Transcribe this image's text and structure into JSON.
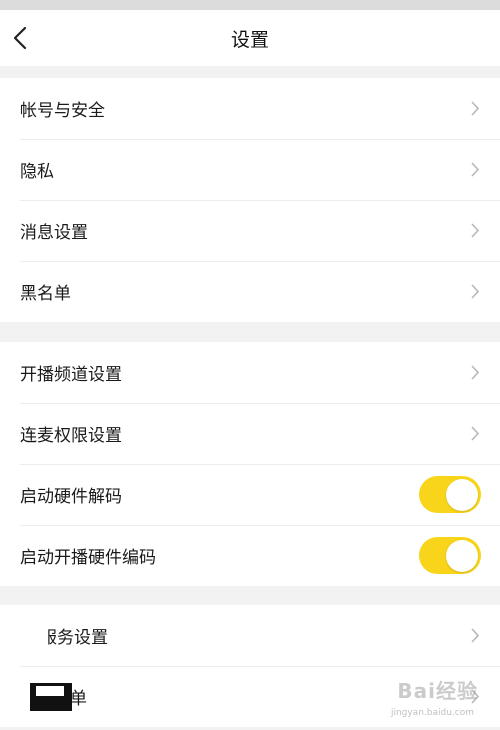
{
  "header": {
    "title": "设置"
  },
  "groups": [
    {
      "items": [
        {
          "label": "帐号与安全",
          "type": "link"
        },
        {
          "label": "隐私",
          "type": "link"
        },
        {
          "label": "消息设置",
          "type": "link"
        },
        {
          "label": "黑名单",
          "type": "link"
        }
      ]
    },
    {
      "items": [
        {
          "label": "开播频道设置",
          "type": "link"
        },
        {
          "label": "连麦权限设置",
          "type": "link"
        },
        {
          "label": "启动硬件解码",
          "type": "toggle",
          "on": true
        },
        {
          "label": "启动开播硬件编码",
          "type": "toggle",
          "on": true
        }
      ]
    },
    {
      "items": [
        {
          "label": "服务设置",
          "type": "link"
        },
        {
          "label": "单",
          "type": "link"
        }
      ]
    }
  ],
  "colors": {
    "accent": "#f8d51a",
    "background": "#f2f2f2",
    "card": "#ffffff"
  },
  "watermark": {
    "text": "Bai经验",
    "url": "jingyan.baidu.com"
  }
}
